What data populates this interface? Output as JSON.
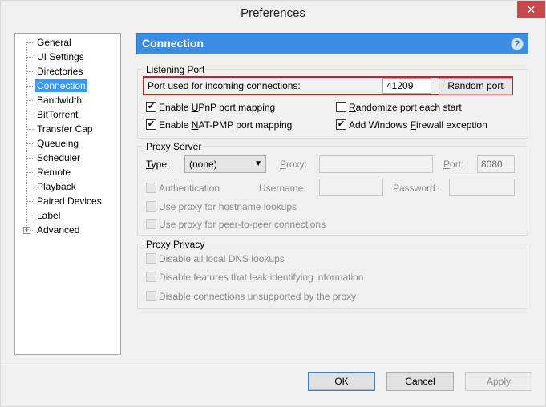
{
  "window": {
    "title": "Preferences",
    "close_glyph": "✕"
  },
  "tree": {
    "items": [
      {
        "label": "General"
      },
      {
        "label": "UI Settings"
      },
      {
        "label": "Directories"
      },
      {
        "label": "Connection",
        "selected": true
      },
      {
        "label": "Bandwidth"
      },
      {
        "label": "BitTorrent"
      },
      {
        "label": "Transfer Cap"
      },
      {
        "label": "Queueing"
      },
      {
        "label": "Scheduler"
      },
      {
        "label": "Remote"
      },
      {
        "label": "Playback"
      },
      {
        "label": "Paired Devices"
      },
      {
        "label": "Label"
      },
      {
        "label": "Advanced",
        "expandable": true
      }
    ],
    "expander_glyph": "+"
  },
  "panel": {
    "title": "Connection",
    "help_glyph": "?"
  },
  "listening_port": {
    "group_label": "Listening Port",
    "port_label": "Port used for incoming connections:",
    "port_value": "41209",
    "random_port_button": "Random port",
    "upnp": {
      "label_pre": "Enable ",
      "label_accel": "U",
      "label_post": "PnP port mapping",
      "checked": true
    },
    "natpmp": {
      "label_pre": "Enable ",
      "label_accel": "N",
      "label_post": "AT-PMP port mapping",
      "checked": true
    },
    "randomize": {
      "label_pre": "",
      "label_accel": "R",
      "label_post": "andomize port each start",
      "checked": false
    },
    "firewall": {
      "label_pre": "Add Windows ",
      "label_accel": "F",
      "label_post": "irewall exception",
      "checked": true
    }
  },
  "proxy_server": {
    "group_label": "Proxy Server",
    "type_label_accel": "T",
    "type_label_post": "ype:",
    "type_value": "(none)",
    "proxy_label_accel": "P",
    "proxy_label_post": "roxy:",
    "proxy_value": "",
    "port_label_accel": "P",
    "port_label_post": "ort:",
    "port_value": "8080",
    "authentication_label": "Authentication",
    "username_label": "Username:",
    "password_label": "Password:",
    "hostname_lookups_label": "Use proxy for hostname lookups",
    "p2p_label": "Use proxy for peer-to-peer connections"
  },
  "proxy_privacy": {
    "group_label": "Proxy Privacy",
    "dns_label": "Disable all local DNS lookups",
    "leak_label": "Disable features that leak identifying information",
    "unsupported_label": "Disable connections unsupported by the proxy"
  },
  "footer": {
    "ok": "OK",
    "cancel": "Cancel",
    "apply": "Apply"
  },
  "check_glyph": "✔"
}
